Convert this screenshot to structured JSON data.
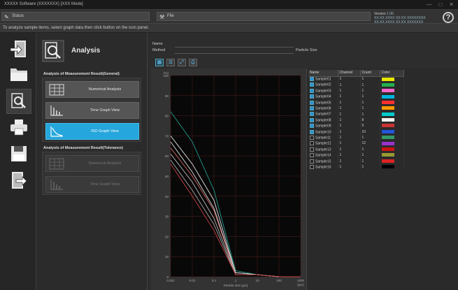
{
  "window": {
    "title": "XXXXX Software (XXXXXXX) [XXX Mode]",
    "min": "—",
    "max": "□",
    "close": "✕"
  },
  "topbar": {
    "status_label": "Status",
    "file_label": "File",
    "version_label": "Version",
    "version_value": "1.00",
    "device_lines": [
      "XX.XX.XXXX  XX:XX  XXXXXXXX",
      "XX.XX.XXXX  XX:XX  XXXXXXX"
    ],
    "help_glyph": "?"
  },
  "notice": {
    "text": "To analyze sample items, select graph data then click button on the icon panel."
  },
  "nav": [
    {
      "name": "import-icon"
    },
    {
      "name": "folder-icon"
    },
    {
      "name": "analysis-icon",
      "active": true
    },
    {
      "name": "print-icon"
    },
    {
      "name": "save-icon"
    },
    {
      "name": "exit-icon"
    }
  ],
  "panel": {
    "title": "Analysis",
    "section1": "Analysis of Measurement Result(General)",
    "section2": "Analysis of Measurement Result(Tolerance)",
    "buttons_general": [
      {
        "label": "Numerical Analysis",
        "icon": "table-icon",
        "state": "normal"
      },
      {
        "label": "Time Graph View",
        "icon": "time-graph-icon",
        "state": "normal"
      },
      {
        "label": "ISO Graph View",
        "icon": "iso-graph-icon",
        "state": "selected"
      }
    ],
    "buttons_tolerance": [
      {
        "label": "Numerical Analysis",
        "icon": "table-icon",
        "state": "disabled"
      },
      {
        "label": "Time Graph View",
        "icon": "time-graph-icon",
        "state": "disabled"
      }
    ]
  },
  "main": {
    "field1_label": "Name",
    "field2_label": "Method",
    "field2_value": "Particle Size",
    "table_headers": [
      "Name",
      "Channel",
      "Count",
      "Color"
    ],
    "rows": [
      {
        "name": "Sample01",
        "channel": "1",
        "count": "1",
        "checked": true,
        "color": "#e8e800"
      },
      {
        "name": "Sample02",
        "channel": "1",
        "count": "1",
        "checked": true,
        "color": "#22b14c"
      },
      {
        "name": "Sample03",
        "channel": "1",
        "count": "1",
        "checked": true,
        "color": "#ff66cc"
      },
      {
        "name": "Sample04",
        "channel": "1",
        "count": "1",
        "checked": true,
        "color": "#00b4e0"
      },
      {
        "name": "Sample05",
        "channel": "1",
        "count": "1",
        "checked": true,
        "color": "#ff3030"
      },
      {
        "name": "Sample06",
        "channel": "1",
        "count": "1",
        "checked": true,
        "color": "#ff9a00"
      },
      {
        "name": "Sample07",
        "channel": "1",
        "count": "1",
        "checked": true,
        "color": "#00cccc"
      },
      {
        "name": "Sample08",
        "channel": "1",
        "count": "8",
        "checked": true,
        "color": "#f2f2f2"
      },
      {
        "name": "Sample09",
        "channel": "1",
        "count": "9",
        "checked": true,
        "color": "#cc3333"
      },
      {
        "name": "Sample10",
        "channel": "1",
        "count": "10",
        "checked": true,
        "color": "#2255dd"
      },
      {
        "name": "Sample11",
        "channel": "1",
        "count": "1",
        "checked": false,
        "color": "#339966"
      },
      {
        "name": "Sample12",
        "channel": "1",
        "count": "12",
        "checked": false,
        "color": "#9933cc"
      },
      {
        "name": "Sample13",
        "channel": "1",
        "count": "1",
        "checked": false,
        "color": "#cc1111"
      },
      {
        "name": "Sample14",
        "channel": "1",
        "count": "1",
        "checked": false,
        "color": "#999933"
      },
      {
        "name": "Sample15",
        "channel": "1",
        "count": "1",
        "checked": false,
        "color": "#dd2222"
      },
      {
        "name": "Sample16",
        "channel": "1",
        "count": "1",
        "checked": false,
        "color": "#000000"
      }
    ]
  },
  "chart_data": {
    "type": "line",
    "title": "",
    "xlabel": "Particle size (μm)",
    "ylabel": "",
    "x_ticks": [
      "0.001",
      "0.01",
      "0.1",
      "1",
      "10",
      "100",
      "1000"
    ],
    "y_ticks": [
      "100",
      "90",
      "80",
      "70",
      "60",
      "50",
      "40",
      "30",
      "20",
      "10",
      "0"
    ],
    "y_top_label": "(%)",
    "x_unit": "(μm)",
    "x": [
      "0.001",
      "0.01",
      "0.1",
      "1",
      "10",
      "100",
      "1000"
    ],
    "ylim": [
      0,
      100
    ],
    "grid": true,
    "series": [
      {
        "color": "#1f9c8c",
        "values": [
          82,
          67,
          43,
          3,
          1,
          0,
          0
        ]
      },
      {
        "color": "#e6e6e6",
        "values": [
          70,
          56,
          38,
          2,
          1,
          0,
          0
        ]
      },
      {
        "color": "#d9d9d9",
        "values": [
          67,
          52,
          34,
          2,
          1,
          0,
          0
        ]
      },
      {
        "color": "#cc6666",
        "values": [
          64,
          50,
          33,
          1,
          1,
          0,
          0
        ]
      },
      {
        "color": "#b8b8b8",
        "values": [
          61,
          47,
          29,
          1,
          1,
          0,
          0
        ]
      },
      {
        "color": "#a8a8a8",
        "values": [
          58,
          43,
          26,
          1,
          1,
          0,
          0
        ]
      },
      {
        "color": "#c44",
        "values": [
          56,
          40,
          23,
          1,
          1,
          0,
          0
        ]
      }
    ]
  }
}
